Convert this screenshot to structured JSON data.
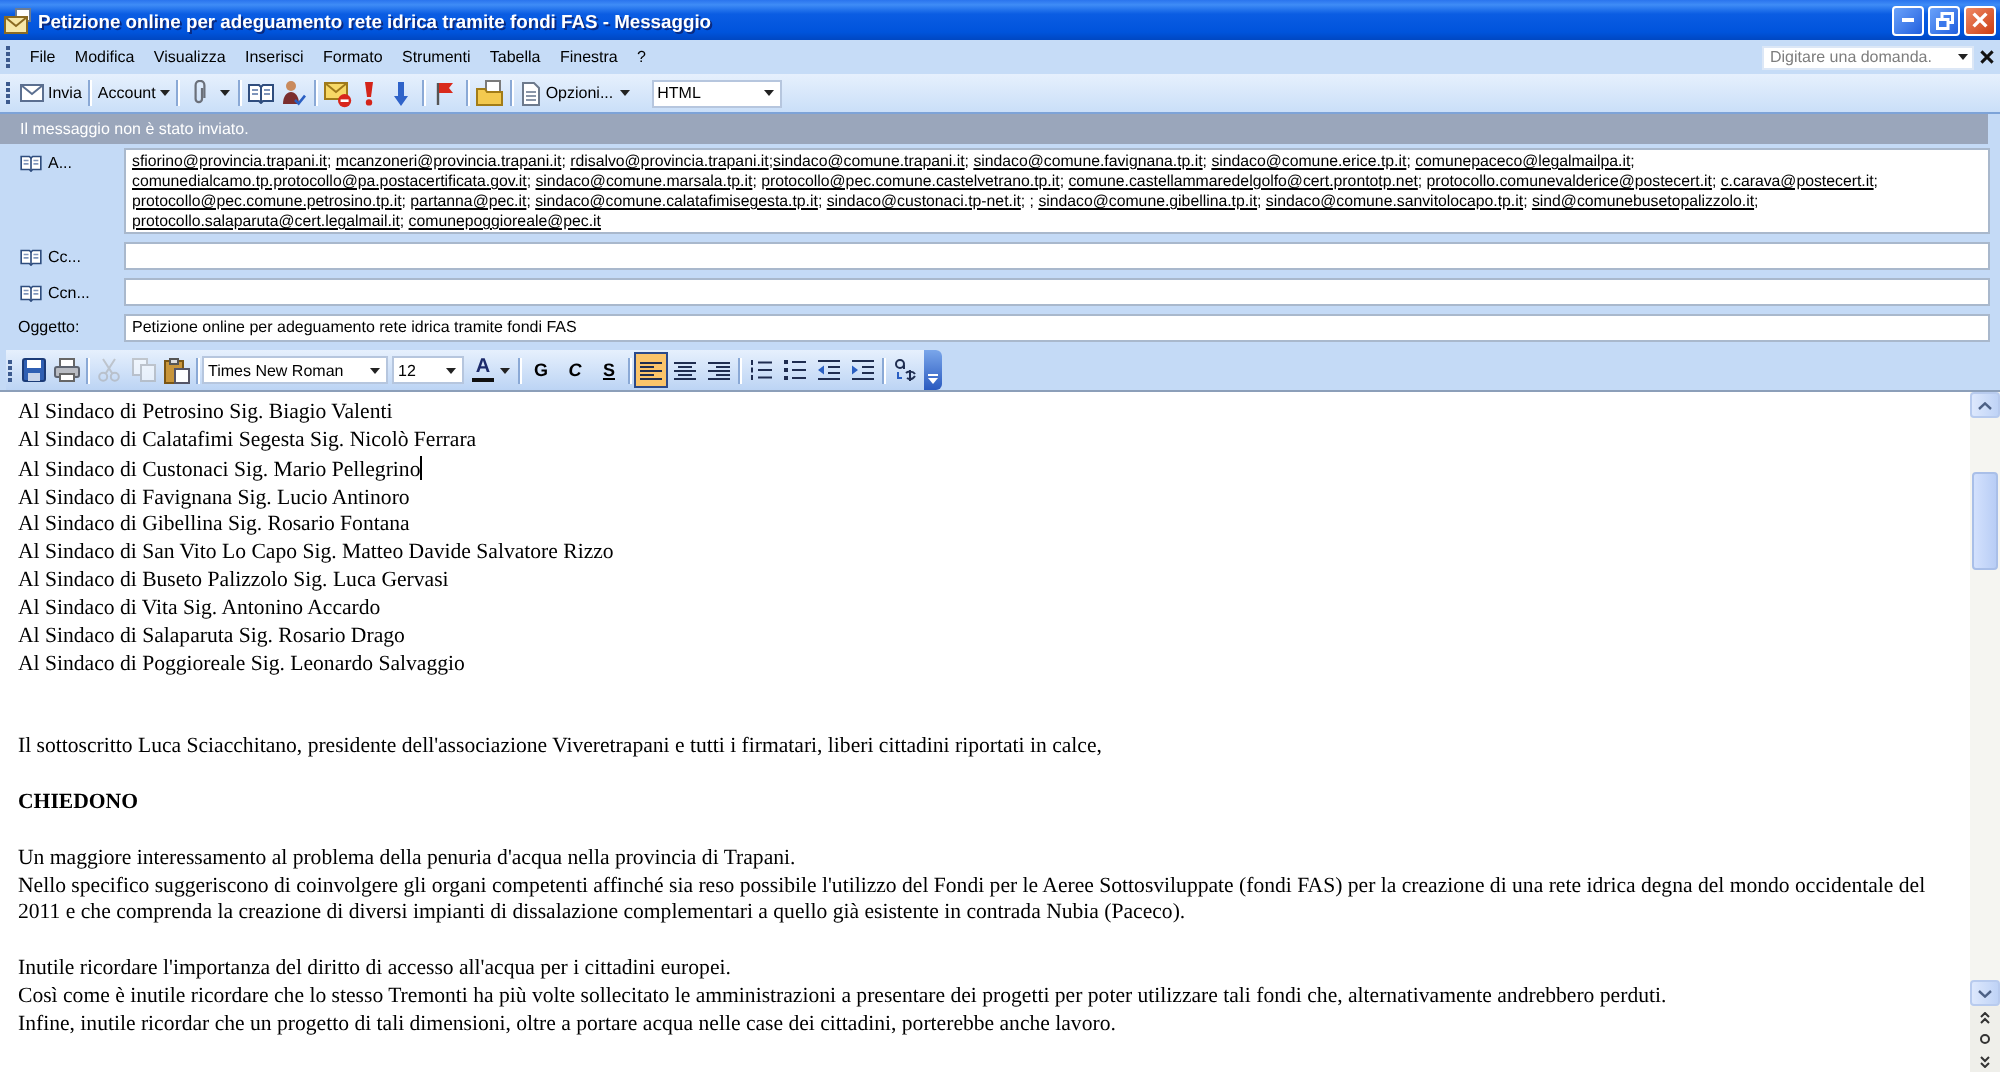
{
  "window": {
    "title": "Petizione online per adeguamento rete idrica tramite fondi FAS - Messaggio"
  },
  "menu_bar": {
    "items": [
      "File",
      "Modifica",
      "Visualizza",
      "Inserisci",
      "Formato",
      "Strumenti",
      "Tabella",
      "Finestra",
      "?"
    ],
    "help_search": {
      "placeholder": "Digitare una domanda."
    }
  },
  "toolbar": {
    "send": "Invia",
    "account": "Account",
    "options": "Opzioni...",
    "message_format": "HTML"
  },
  "info_bar": {
    "text": "Il messaggio non è stato inviato."
  },
  "header": {
    "to": {
      "label": "A...",
      "recipients": [
        {
          "address": "sfiorino@provincia.trapani.it",
          "separator": "; "
        },
        {
          "address": "mcanzoneri@provincia.trapani.it",
          "separator": "; "
        },
        {
          "address": "rdisalvo@provincia.trapani.it",
          "separator": ";"
        },
        {
          "address": "sindaco@comune.trapani.it",
          "separator": "; "
        },
        {
          "address": "sindaco@comune.favignana.tp.it",
          "separator": "; "
        },
        {
          "address": "sindaco@comune.erice.tp.it",
          "separator": "; "
        },
        {
          "address": "comunepaceco@legalmailpa.it",
          "separator": "; "
        },
        {
          "address": "comunedialcamo.tp.protocollo@pa.postacertificata.gov.it",
          "separator": "; "
        },
        {
          "address": "sindaco@comune.marsala.tp.it",
          "separator": "; "
        },
        {
          "address": "protocollo@pec.comune.castelvetrano.tp.it",
          "separator": "; "
        },
        {
          "address": "comune.castellammaredelgolfo@cert.prontotp.net",
          "separator": "; "
        },
        {
          "address": "protocollo.comunevalderice@postecert.it",
          "separator": "; "
        },
        {
          "address": "c.carava@postecert.it",
          "separator": "; "
        },
        {
          "address": "protocollo@pec.comune.petrosino.tp.it",
          "separator": "; "
        },
        {
          "address": "partanna@pec.it",
          "separator": "; "
        },
        {
          "address": "sindaco@comune.calatafimisegesta.tp.it",
          "separator": "; "
        },
        {
          "address": "sindaco@custonaci.tp-net.it",
          "separator": "; "
        },
        {
          "separator": "; "
        },
        {
          "address": "sindaco@comune.gibellina.tp.it",
          "separator": "; "
        },
        {
          "address": "sindaco@comune.sanvitolocapo.tp.it",
          "separator": "; "
        },
        {
          "address": "sind@comunebusetopalizzolo.it",
          "separator": "; "
        },
        {
          "address": "protocollo.salaparuta@cert.legalmail.it",
          "separator": "; "
        },
        {
          "address": "comunepoggioreale@pec.it"
        }
      ]
    },
    "cc": {
      "label": "Cc..."
    },
    "bcc": {
      "label": "Ccn..."
    },
    "subject": {
      "label": "Oggetto:",
      "value": "Petizione online per adeguamento rete idrica tramite fondi FAS"
    }
  },
  "format_toolbar": {
    "edit_buttons": [
      {
        "kind": "cut",
        "disabled": true
      },
      {
        "kind": "copy",
        "disabled": true
      },
      {
        "kind": "paste",
        "disabled": false
      }
    ],
    "font": "Times New Roman",
    "size": "12",
    "font_color": "A",
    "styles": [
      {
        "kind": "bold",
        "label": "G"
      },
      {
        "kind": "italic",
        "label": "C"
      },
      {
        "kind": "underline",
        "label": "S"
      }
    ],
    "alignment": [
      {
        "kind": "left",
        "selected": true
      },
      {
        "kind": "center",
        "selected": false
      },
      {
        "kind": "right",
        "selected": false
      }
    ]
  },
  "body": {
    "blocks": [
      {
        "kind": "list",
        "lines": [
          {
            "text": "Al Sindaco di Petrosino Sig. Biagio Valenti",
            "cursor": false
          },
          {
            "text": "Al Sindaco di Calatafimi Segesta Sig. Nicolò Ferrara",
            "cursor": false
          },
          {
            "text": "Al Sindaco di Custonaci Sig. Mario Pellegrino",
            "cursor": true
          },
          {
            "text": "Al Sindaco di Favignana Sig. Lucio Antinoro",
            "cursor": false
          },
          {
            "text": "Al Sindaco di Gibellina Sig. Rosario Fontana",
            "cursor": false
          },
          {
            "text": "Al Sindaco di San Vito Lo Capo Sig. Matteo Davide Salvatore Rizzo",
            "cursor": false
          },
          {
            "text": "Al Sindaco di Buseto Palizzolo Sig. Luca Gervasi",
            "cursor": false
          },
          {
            "text": "Al Sindaco di Vita Sig. Antonino Accardo",
            "cursor": false
          },
          {
            "text": "Al Sindaco di Salaparuta Sig. Rosario Drago",
            "cursor": false
          },
          {
            "text": "Al Sindaco di Poggioreale Sig. Leonardo Salvaggio",
            "cursor": false
          }
        ]
      },
      {
        "kind": "paragraph",
        "lines": [
          {
            "text": "Il sottoscritto Luca Sciacchitano, presidente dell'associazione Viveretrapani e tutti i firmatari, liberi cittadini riportati in calce,",
            "cursor": false
          }
        ]
      },
      {
        "kind": "heading",
        "lines": [
          {
            "text": "CHIEDONO",
            "cursor": false
          }
        ]
      },
      {
        "kind": "paragraph",
        "lines": [
          {
            "text": "Un maggiore interessamento al problema della penuria d'acqua nella provincia di Trapani.",
            "cursor": false
          },
          {
            "text": "Nello specifico suggeriscono di coinvolgere gli organi competenti affinché sia reso possibile l'utilizzo del Fondi per le Aeree Sottosviluppate (fondi FAS) per la creazione di una rete idrica degna del mondo occidentale del 2011 e che comprenda la creazione di diversi impianti di dissalazione complementari a quello già esistente in contrada Nubia (Paceco).",
            "cursor": false
          }
        ]
      },
      {
        "kind": "paragraph",
        "lines": [
          {
            "text": "Inutile ricordare l'importanza del diritto di accesso all'acqua per i cittadini europei.",
            "cursor": false
          },
          {
            "text": "Così come è inutile ricordare che lo stesso Tremonti ha più volte sollecitato le amministrazioni a presentare dei progetti per poter utilizzare tali fondi che, alternativamente andrebbero perduti.",
            "cursor": false
          },
          {
            "text": "Infine, inutile ricordar che un progetto di tali dimensioni, oltre a portare acqua nelle case dei cittadini, porterebbe anche lavoro.",
            "cursor": false
          }
        ]
      }
    ]
  }
}
